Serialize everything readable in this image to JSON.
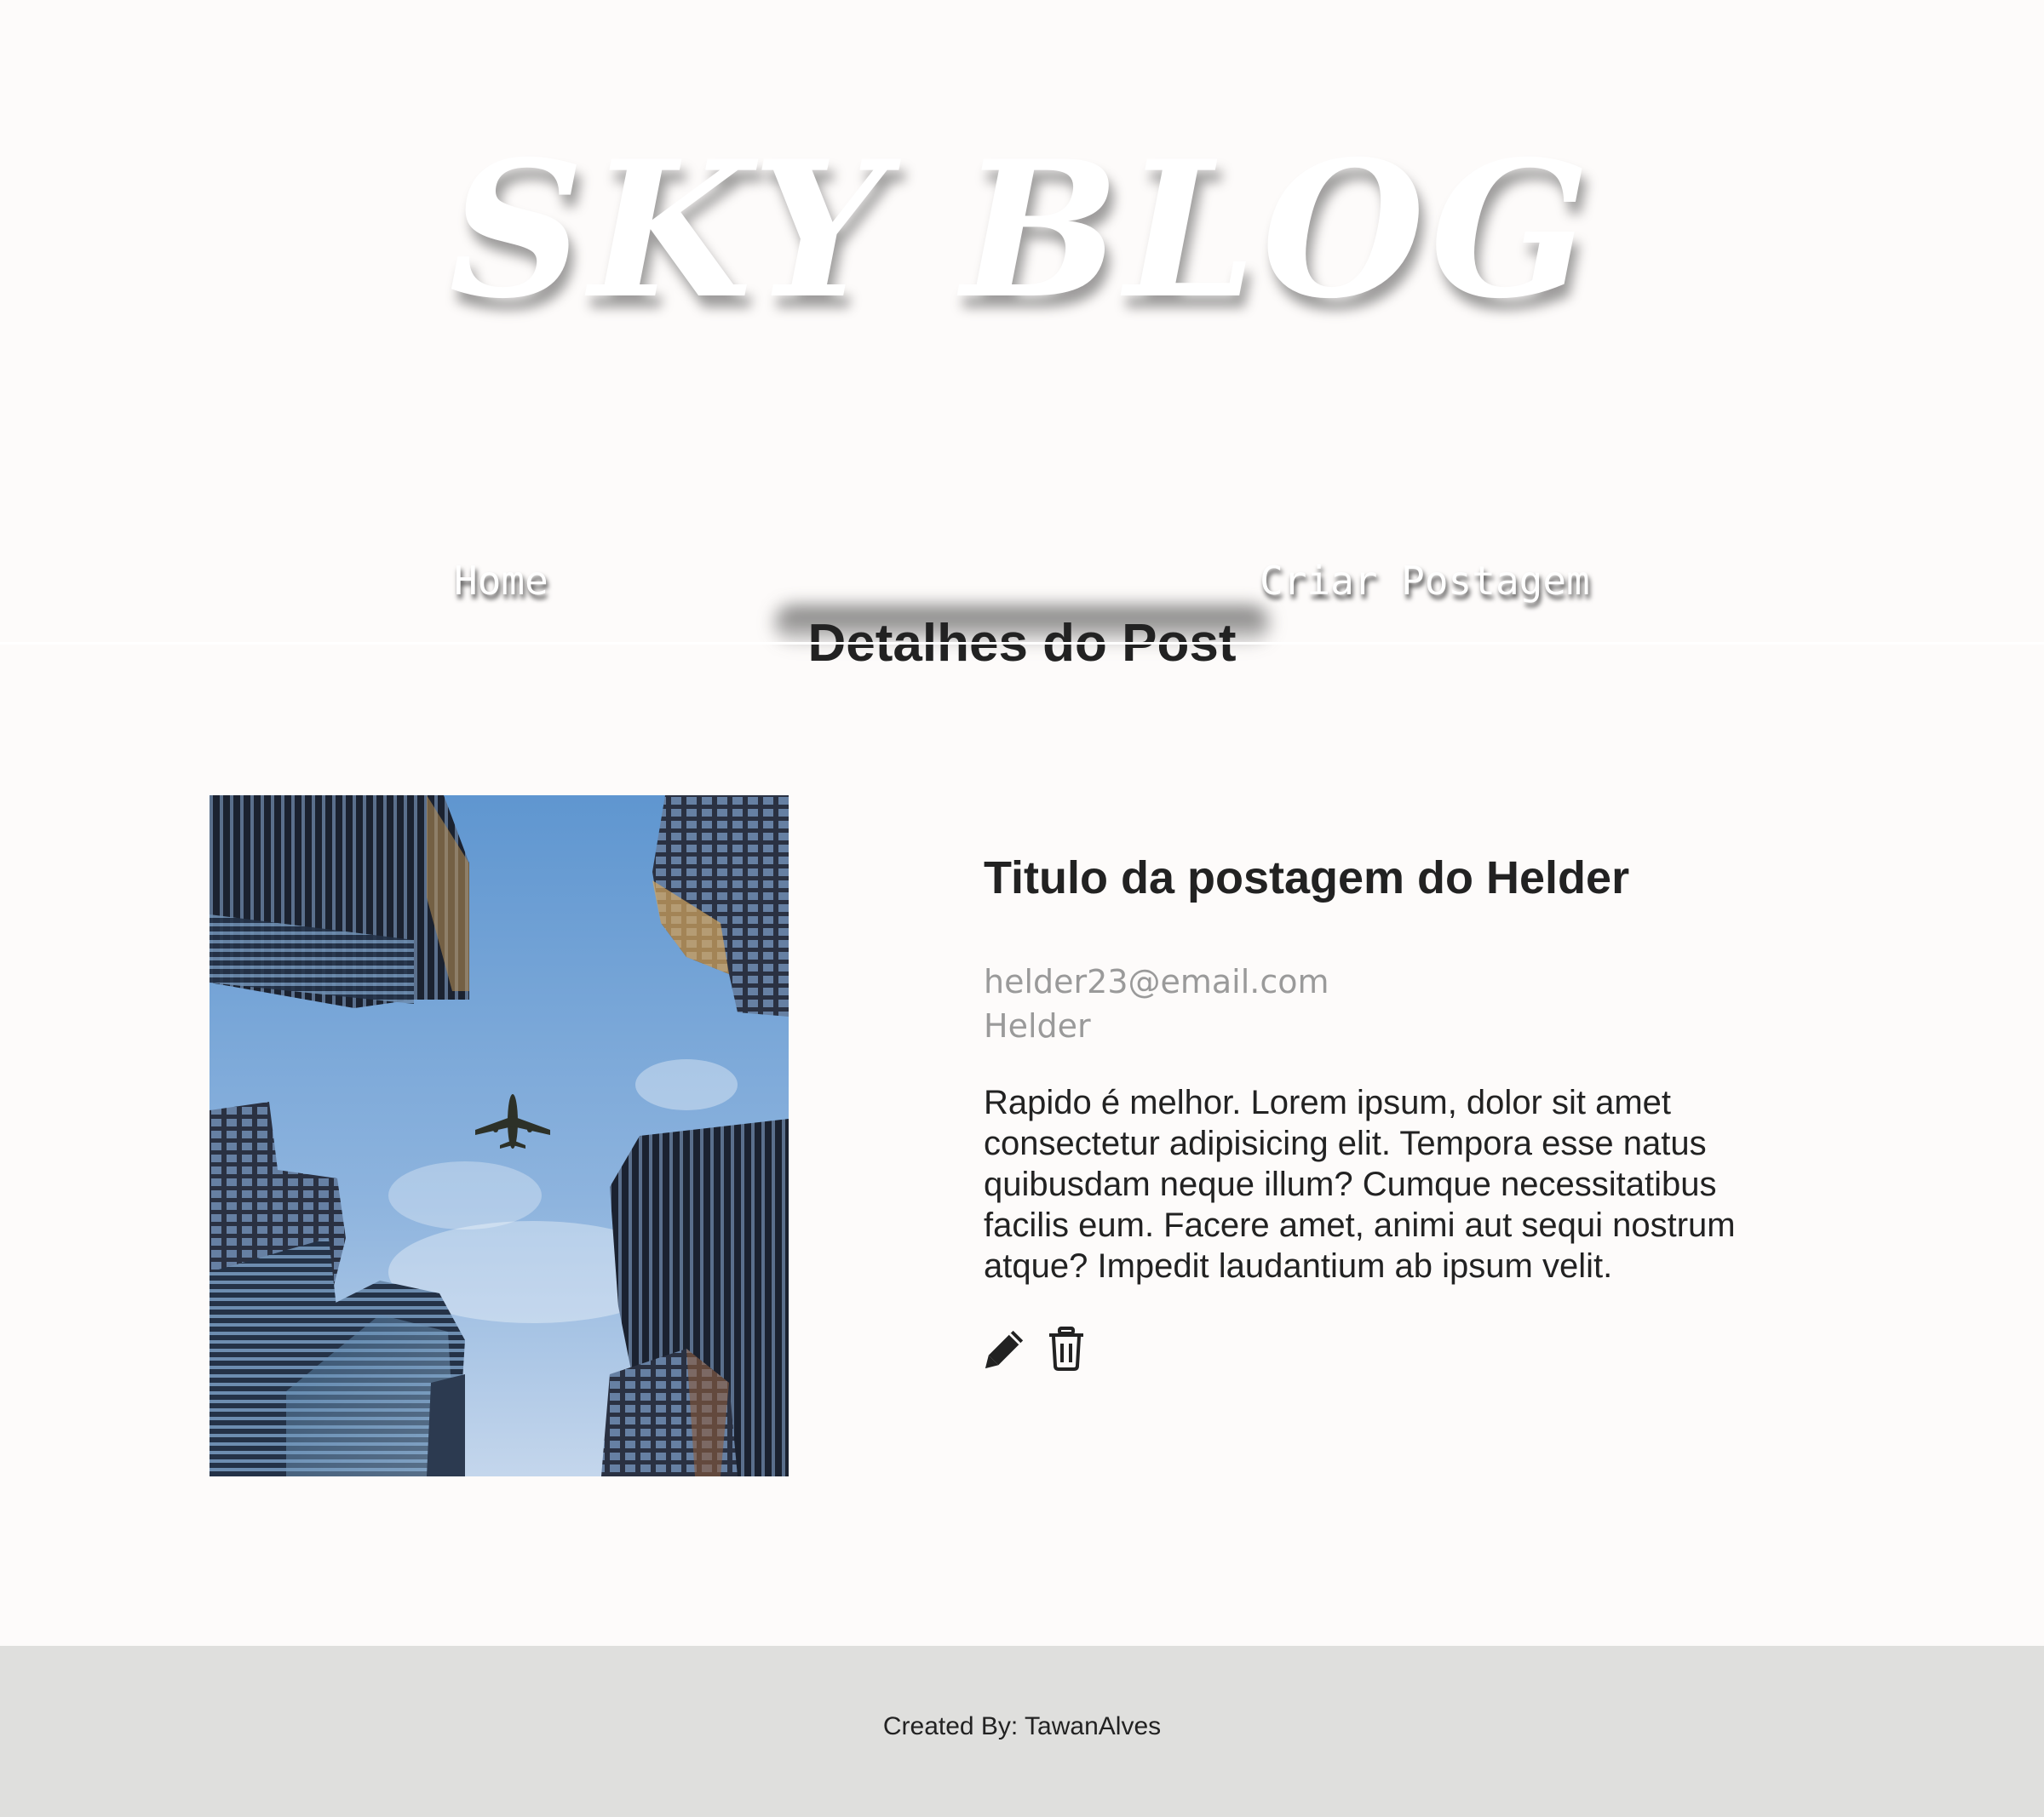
{
  "header": {
    "site_title": "SKY BLOG",
    "nav": {
      "home": "Home",
      "create_post": "Criar Postagem"
    }
  },
  "page": {
    "section_title": "Detalhes do Post"
  },
  "post": {
    "image_alt": "city-skyline-with-airplane",
    "title": "Titulo da postagem do Helder",
    "email": "helder23@email.com",
    "author": "Helder",
    "text": "Rapido é melhor. Lorem ipsum, dolor sit amet consectetur adipisicing elit. Tempora esse natus quibusdam neque illum? Cumque necessitatibus facilis eum. Facere amet, animi aut sequi nostrum atque? Impedit laudantium ab ipsum velit.",
    "actions": {
      "edit_icon": "pencil-icon",
      "delete_icon": "trash-icon"
    }
  },
  "footer": {
    "text": "Created By: TawanAlves"
  },
  "colors": {
    "background": "#fdfbfa",
    "footer_background": "#dfdfdd",
    "text": "#222222",
    "muted": "#9a9a9a"
  }
}
